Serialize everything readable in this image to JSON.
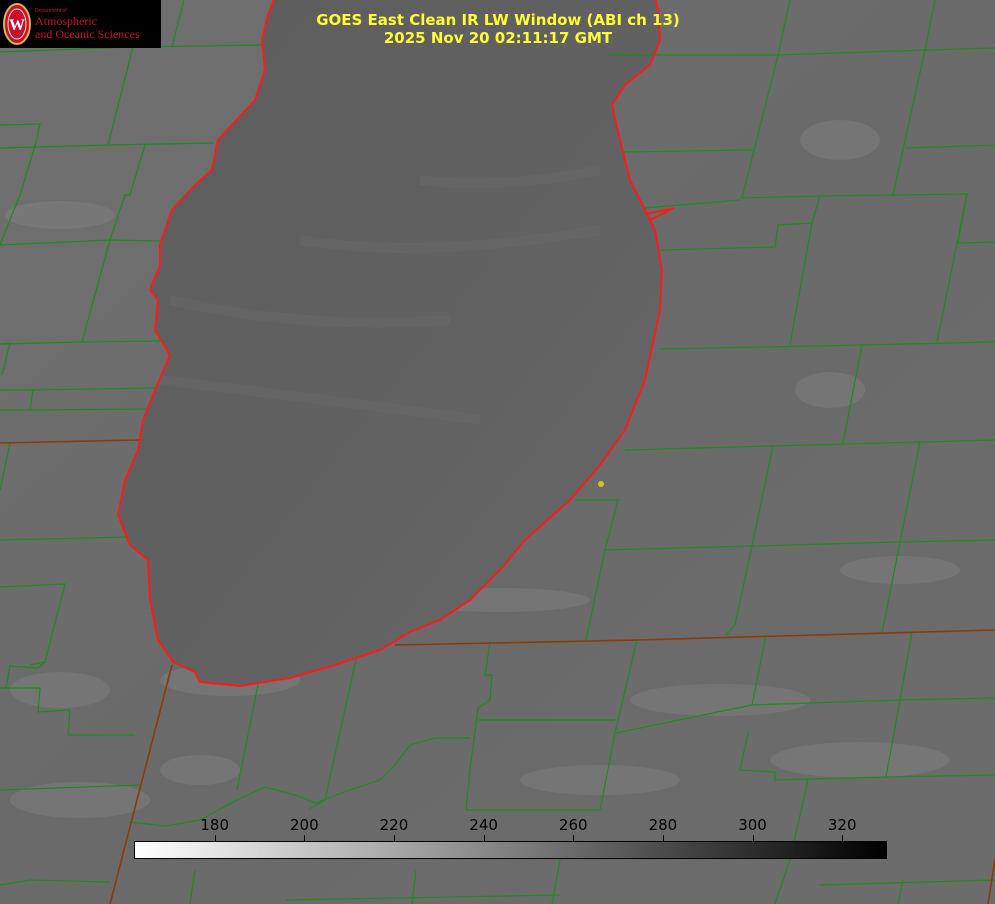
{
  "title": {
    "line1": "GOES East Clean IR LW Window (ABI ch 13)",
    "line2": "2025 Nov 20 02:11:17 GMT"
  },
  "logo": {
    "small": "Department of",
    "line1": "Atmospheric",
    "line2": "and Oceanic Sciences",
    "seal_letter": "W"
  },
  "colorbar": {
    "ticks": [
      "180",
      "200",
      "220",
      "240",
      "260",
      "280",
      "300",
      "320"
    ],
    "tick_values": [
      180,
      200,
      220,
      240,
      260,
      280,
      300,
      320
    ],
    "range": [
      162,
      330
    ],
    "colors": [
      "#ffffff",
      "#000000"
    ]
  },
  "colors": {
    "county_lines": "#1f8a1f",
    "state_lines": "#8b3a0a",
    "lake_outline": "#ff1a1a",
    "title_text": "#ffff33",
    "marker": "#d4c21a"
  },
  "marker_icon": "yellow-dot"
}
